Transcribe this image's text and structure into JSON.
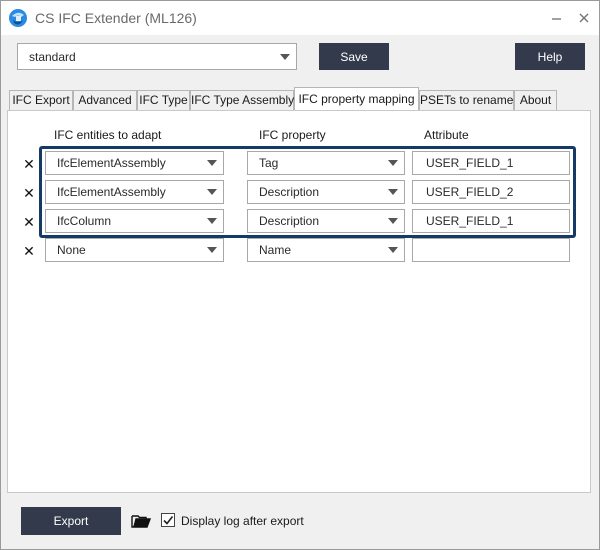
{
  "window": {
    "title": "CS IFC Extender (ML126)",
    "minimize_glyph": "—",
    "close_glyph": "✕"
  },
  "toolbar": {
    "preset_value": "standard",
    "save_label": "Save",
    "help_label": "Help"
  },
  "tabs": [
    {
      "label": "IFC Export",
      "active": false
    },
    {
      "label": "Advanced",
      "active": false
    },
    {
      "label": "IFC Type",
      "active": false
    },
    {
      "label": "IFC Type Assembly",
      "active": false
    },
    {
      "label": "IFC property mapping",
      "active": true
    },
    {
      "label": "PSETs to rename",
      "active": false
    },
    {
      "label": "About",
      "active": false
    }
  ],
  "mapping": {
    "headers": {
      "entity": "IFC entities to adapt",
      "property": "IFC property",
      "attribute": "Attribute"
    },
    "delete_glyph": "✕",
    "rows": [
      {
        "entity": "IfcElementAssembly",
        "property": "Tag",
        "attribute": "USER_FIELD_1"
      },
      {
        "entity": "IfcElementAssembly",
        "property": "Description",
        "attribute": "USER_FIELD_2"
      },
      {
        "entity": "IfcColumn",
        "property": "Description",
        "attribute": "USER_FIELD_1"
      },
      {
        "entity": "None",
        "property": "Name",
        "attribute": ""
      }
    ]
  },
  "footer": {
    "export_label": "Export",
    "display_log_label": "Display log after export",
    "display_log_checked": true
  },
  "colors": {
    "dark_button": "#333a4b",
    "highlight_border": "#163a66",
    "icon_blue": "#1f7fd6"
  }
}
